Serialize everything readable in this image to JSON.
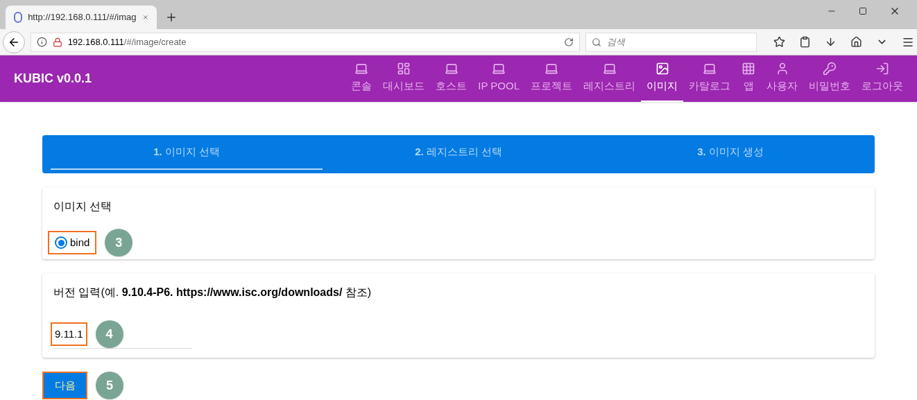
{
  "browser": {
    "tab_title": "http://192.168.0.111/#/imag",
    "url_host": "192.168.0.111",
    "url_path": "/#/image/create",
    "search_placeholder": "검색"
  },
  "app": {
    "brand": "KUBIC v0.0.1",
    "nav": [
      {
        "label": "콘솔",
        "kind": "laptop",
        "selected": false
      },
      {
        "label": "대시보드",
        "kind": "dashboard",
        "selected": false
      },
      {
        "label": "호스트",
        "kind": "laptop",
        "selected": false
      },
      {
        "label": "IP POOL",
        "kind": "laptop",
        "selected": false
      },
      {
        "label": "프로젝트",
        "kind": "laptop",
        "selected": false
      },
      {
        "label": "레지스트리",
        "kind": "laptop",
        "selected": false
      },
      {
        "label": "이미지",
        "kind": "image",
        "selected": true
      },
      {
        "label": "카탈로그",
        "kind": "laptop",
        "selected": false
      },
      {
        "label": "앱",
        "kind": "apps",
        "selected": false
      },
      {
        "label": "사용자",
        "kind": "user",
        "selected": false
      },
      {
        "label": "비밀번호",
        "kind": "key",
        "selected": false
      },
      {
        "label": "로그아웃",
        "kind": "logout",
        "selected": false
      }
    ]
  },
  "steps": [
    {
      "number": "1.",
      "label": "이미지 선택",
      "selected": true
    },
    {
      "number": "2.",
      "label": "레지스트리 선택",
      "selected": false
    },
    {
      "number": "3.",
      "label": "이미지 생성",
      "selected": false
    }
  ],
  "image_card": {
    "title": "이미지 선택",
    "options": [
      {
        "label": "bind",
        "selected": true
      }
    ],
    "badge": "3"
  },
  "version_card": {
    "title": "버전 입력(예. **9.10.4-P6. https://www.isc.org/downloads/** 참조)",
    "value": "9.11.1",
    "badge": "4"
  },
  "next_button": {
    "label": "다음",
    "badge": "5"
  }
}
